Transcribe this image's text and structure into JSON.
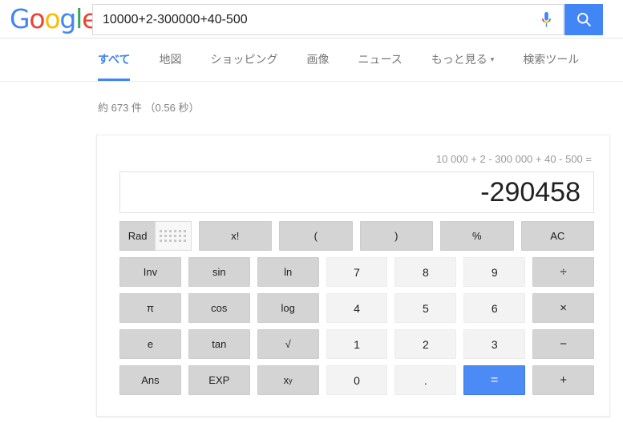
{
  "brand": {
    "name": "Google",
    "letters": [
      {
        "char": "G",
        "color": "#4285f4"
      },
      {
        "char": "o",
        "color": "#ea4335"
      },
      {
        "char": "o",
        "color": "#fbbc05"
      },
      {
        "char": "g",
        "color": "#4285f4"
      },
      {
        "char": "l",
        "color": "#34a853"
      },
      {
        "char": "e",
        "color": "#ea4335"
      }
    ]
  },
  "search": {
    "query": "10000+2-300000+40-500",
    "placeholder": "",
    "mic_icon": "microphone-icon",
    "search_icon": "search-icon",
    "accent": "#4285f4"
  },
  "tabs": [
    {
      "label": "すべて",
      "active": true
    },
    {
      "label": "地図",
      "active": false
    },
    {
      "label": "ショッピング",
      "active": false
    },
    {
      "label": "画像",
      "active": false
    },
    {
      "label": "ニュース",
      "active": false
    },
    {
      "label": "もっと見る",
      "active": false,
      "caret": "▾"
    },
    {
      "label": "検索ツール",
      "active": false
    }
  ],
  "result_stats": "約 673 件 （0.56 秒）",
  "calculator": {
    "expression": "10 000 + 2 - 300 000 + 40 - 500 =",
    "result": "-290458",
    "equals_color": "#4c8bf5",
    "rows": [
      [
        {
          "label": "Rad",
          "type": "fn",
          "name": "rad-button"
        },
        {
          "label": "",
          "type": "toggle",
          "name": "keypad-icon",
          "icon": "keypad-grid-icon"
        },
        {
          "label": "x!",
          "type": "fn",
          "name": "factorial-button"
        },
        {
          "label": "(",
          "type": "fn",
          "name": "open-paren-button"
        },
        {
          "label": ")",
          "type": "fn",
          "name": "close-paren-button"
        },
        {
          "label": "%",
          "type": "fn",
          "name": "percent-button"
        },
        {
          "label": "AC",
          "type": "fn",
          "name": "all-clear-button"
        }
      ],
      [
        {
          "label": "Inv",
          "type": "fn",
          "name": "inverse-button"
        },
        {
          "label": "sin",
          "type": "fn",
          "name": "sin-button"
        },
        {
          "label": "ln",
          "type": "fn",
          "name": "ln-button"
        },
        {
          "label": "7",
          "type": "num",
          "name": "digit-7-button"
        },
        {
          "label": "8",
          "type": "num",
          "name": "digit-8-button"
        },
        {
          "label": "9",
          "type": "num",
          "name": "digit-9-button"
        },
        {
          "label": "÷",
          "type": "op",
          "name": "divide-button"
        }
      ],
      [
        {
          "label": "π",
          "type": "fn",
          "name": "pi-button"
        },
        {
          "label": "cos",
          "type": "fn",
          "name": "cos-button"
        },
        {
          "label": "log",
          "type": "fn",
          "name": "log-button"
        },
        {
          "label": "4",
          "type": "num",
          "name": "digit-4-button"
        },
        {
          "label": "5",
          "type": "num",
          "name": "digit-5-button"
        },
        {
          "label": "6",
          "type": "num",
          "name": "digit-6-button"
        },
        {
          "label": "×",
          "type": "op",
          "name": "multiply-button"
        }
      ],
      [
        {
          "label": "e",
          "type": "fn",
          "name": "euler-button"
        },
        {
          "label": "tan",
          "type": "fn",
          "name": "tan-button"
        },
        {
          "label": "√",
          "type": "fn",
          "name": "sqrt-button"
        },
        {
          "label": "1",
          "type": "num",
          "name": "digit-1-button"
        },
        {
          "label": "2",
          "type": "num",
          "name": "digit-2-button"
        },
        {
          "label": "3",
          "type": "num",
          "name": "digit-3-button"
        },
        {
          "label": "−",
          "type": "op",
          "name": "minus-button"
        }
      ],
      [
        {
          "label": "Ans",
          "type": "fn",
          "name": "answer-button"
        },
        {
          "label": "EXP",
          "type": "fn",
          "name": "exponent-button"
        },
        {
          "label": "x",
          "sup": "y",
          "type": "fn",
          "name": "power-button"
        },
        {
          "label": "0",
          "type": "num",
          "name": "digit-0-button"
        },
        {
          "label": ".",
          "type": "num",
          "name": "decimal-point-button"
        },
        {
          "label": "=",
          "type": "eq",
          "name": "equals-button"
        },
        {
          "label": "+",
          "type": "op",
          "name": "plus-button"
        }
      ]
    ]
  }
}
